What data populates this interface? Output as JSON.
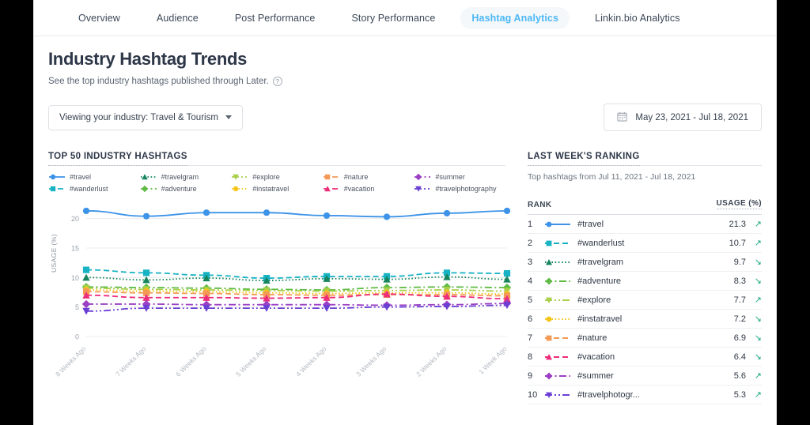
{
  "nav": {
    "tabs": [
      {
        "label": "Overview",
        "active": false
      },
      {
        "label": "Audience",
        "active": false
      },
      {
        "label": "Post Performance",
        "active": false
      },
      {
        "label": "Story Performance",
        "active": false
      },
      {
        "label": "Hashtag Analytics",
        "active": true
      },
      {
        "label": "Linkin.bio Analytics",
        "active": false
      }
    ]
  },
  "header": {
    "title": "Industry Hashtag Trends",
    "subtitle": "See the top industry hashtags published through Later.",
    "help_icon": "question-mark-circle-icon"
  },
  "filters": {
    "industry_label": "Viewing your industry: Travel & Tourism",
    "industry_caret": "chevron-down-icon",
    "date_icon": "calendar-icon",
    "date_range": "May 23, 2021 - Jul 18, 2021"
  },
  "left_panel": {
    "title": "TOP 50 INDUSTRY HASHTAGS",
    "ylabel": "USAGE (%)"
  },
  "right_panel": {
    "title": "LAST WEEK'S RANKING",
    "subtitle": "Top hashtags from Jul 11, 2021 - Jul 18, 2021",
    "col_rank": "RANK",
    "col_usage": "USAGE (%)",
    "rows": [
      {
        "rank": "1",
        "tag": "#travel",
        "usage": "21.3",
        "trend": "up",
        "arrow": "↗"
      },
      {
        "rank": "2",
        "tag": "#wanderlust",
        "usage": "10.7",
        "trend": "up",
        "arrow": "↗"
      },
      {
        "rank": "3",
        "tag": "#travelgram",
        "usage": "9.7",
        "trend": "down",
        "arrow": "↘"
      },
      {
        "rank": "4",
        "tag": "#adventure",
        "usage": "8.3",
        "trend": "down",
        "arrow": "↘"
      },
      {
        "rank": "5",
        "tag": "#explore",
        "usage": "7.7",
        "trend": "up",
        "arrow": "↗"
      },
      {
        "rank": "6",
        "tag": "#instatravel",
        "usage": "7.2",
        "trend": "down",
        "arrow": "↘"
      },
      {
        "rank": "7",
        "tag": "#nature",
        "usage": "6.9",
        "trend": "down",
        "arrow": "↘"
      },
      {
        "rank": "8",
        "tag": "#vacation",
        "usage": "6.4",
        "trend": "down",
        "arrow": "↘"
      },
      {
        "rank": "9",
        "tag": "#summer",
        "usage": "5.6",
        "trend": "up",
        "arrow": "↗"
      },
      {
        "rank": "10",
        "tag": "#travelphotogr...",
        "usage": "5.3",
        "trend": "up",
        "arrow": "↗"
      }
    ]
  },
  "chart_data": {
    "type": "line",
    "title": "TOP 50 INDUSTRY HASHTAGS",
    "xlabel": "",
    "ylabel": "USAGE (%)",
    "ylim": [
      0,
      22.5
    ],
    "yticks": [
      0,
      5,
      10,
      15,
      20
    ],
    "grid": true,
    "legend_position": "top",
    "categories": [
      "8 Weeks Ago",
      "7 Weeks Ago",
      "6 Weeks Ago",
      "5 Weeks Ago",
      "4 Weeks Ago",
      "3 Weeks Ago",
      "2 Weeks Ago",
      "1 Week Ago"
    ],
    "series": [
      {
        "name": "#travel",
        "color": "#3d93e8",
        "marker": "circle",
        "dash": "solid",
        "values": [
          21.3,
          20.4,
          21.0,
          21.0,
          20.5,
          20.3,
          20.9,
          21.3
        ]
      },
      {
        "name": "#wanderlust",
        "color": "#17b3c4",
        "marker": "square",
        "dash": "dashed",
        "values": [
          11.3,
          10.8,
          10.4,
          9.9,
          10.2,
          10.2,
          10.8,
          10.7
        ]
      },
      {
        "name": "#travelgram",
        "color": "#16855e",
        "marker": "triangle-up",
        "dash": "dotted",
        "values": [
          10.0,
          9.6,
          9.9,
          9.5,
          9.8,
          9.7,
          10.1,
          9.7
        ]
      },
      {
        "name": "#adventure",
        "color": "#5fbb45",
        "marker": "diamond",
        "dash": "dashdot",
        "values": [
          8.4,
          8.3,
          8.2,
          8.0,
          7.9,
          8.3,
          8.4,
          8.3
        ]
      },
      {
        "name": "#explore",
        "color": "#a9cf4a",
        "marker": "triangle-down",
        "dash": "dashdotdot",
        "values": [
          8.2,
          8.0,
          7.9,
          7.8,
          7.7,
          7.8,
          7.9,
          7.7
        ]
      },
      {
        "name": "#instatravel",
        "color": "#f5c518",
        "marker": "circle",
        "dash": "dotted",
        "values": [
          7.9,
          7.7,
          7.6,
          7.4,
          7.3,
          7.4,
          7.4,
          7.2
        ]
      },
      {
        "name": "#nature",
        "color": "#f49a55",
        "marker": "square",
        "dash": "dashed",
        "values": [
          7.6,
          7.4,
          7.3,
          7.1,
          7.0,
          7.1,
          7.1,
          6.9
        ]
      },
      {
        "name": "#vacation",
        "color": "#ee2d7a",
        "marker": "triangle-up",
        "dash": "dashed",
        "values": [
          7.0,
          6.6,
          6.6,
          6.5,
          6.6,
          7.2,
          6.8,
          6.4
        ]
      },
      {
        "name": "#summer",
        "color": "#9b3fc4",
        "marker": "diamond",
        "dash": "dashdot",
        "values": [
          5.5,
          5.5,
          5.4,
          5.4,
          5.4,
          5.3,
          5.4,
          5.6
        ]
      },
      {
        "name": "#travelphotography",
        "color": "#6a3fd4",
        "marker": "triangle-down",
        "dash": "dashdotdot",
        "values": [
          4.3,
          4.8,
          4.8,
          4.8,
          4.8,
          5.0,
          5.1,
          5.3
        ]
      }
    ]
  }
}
